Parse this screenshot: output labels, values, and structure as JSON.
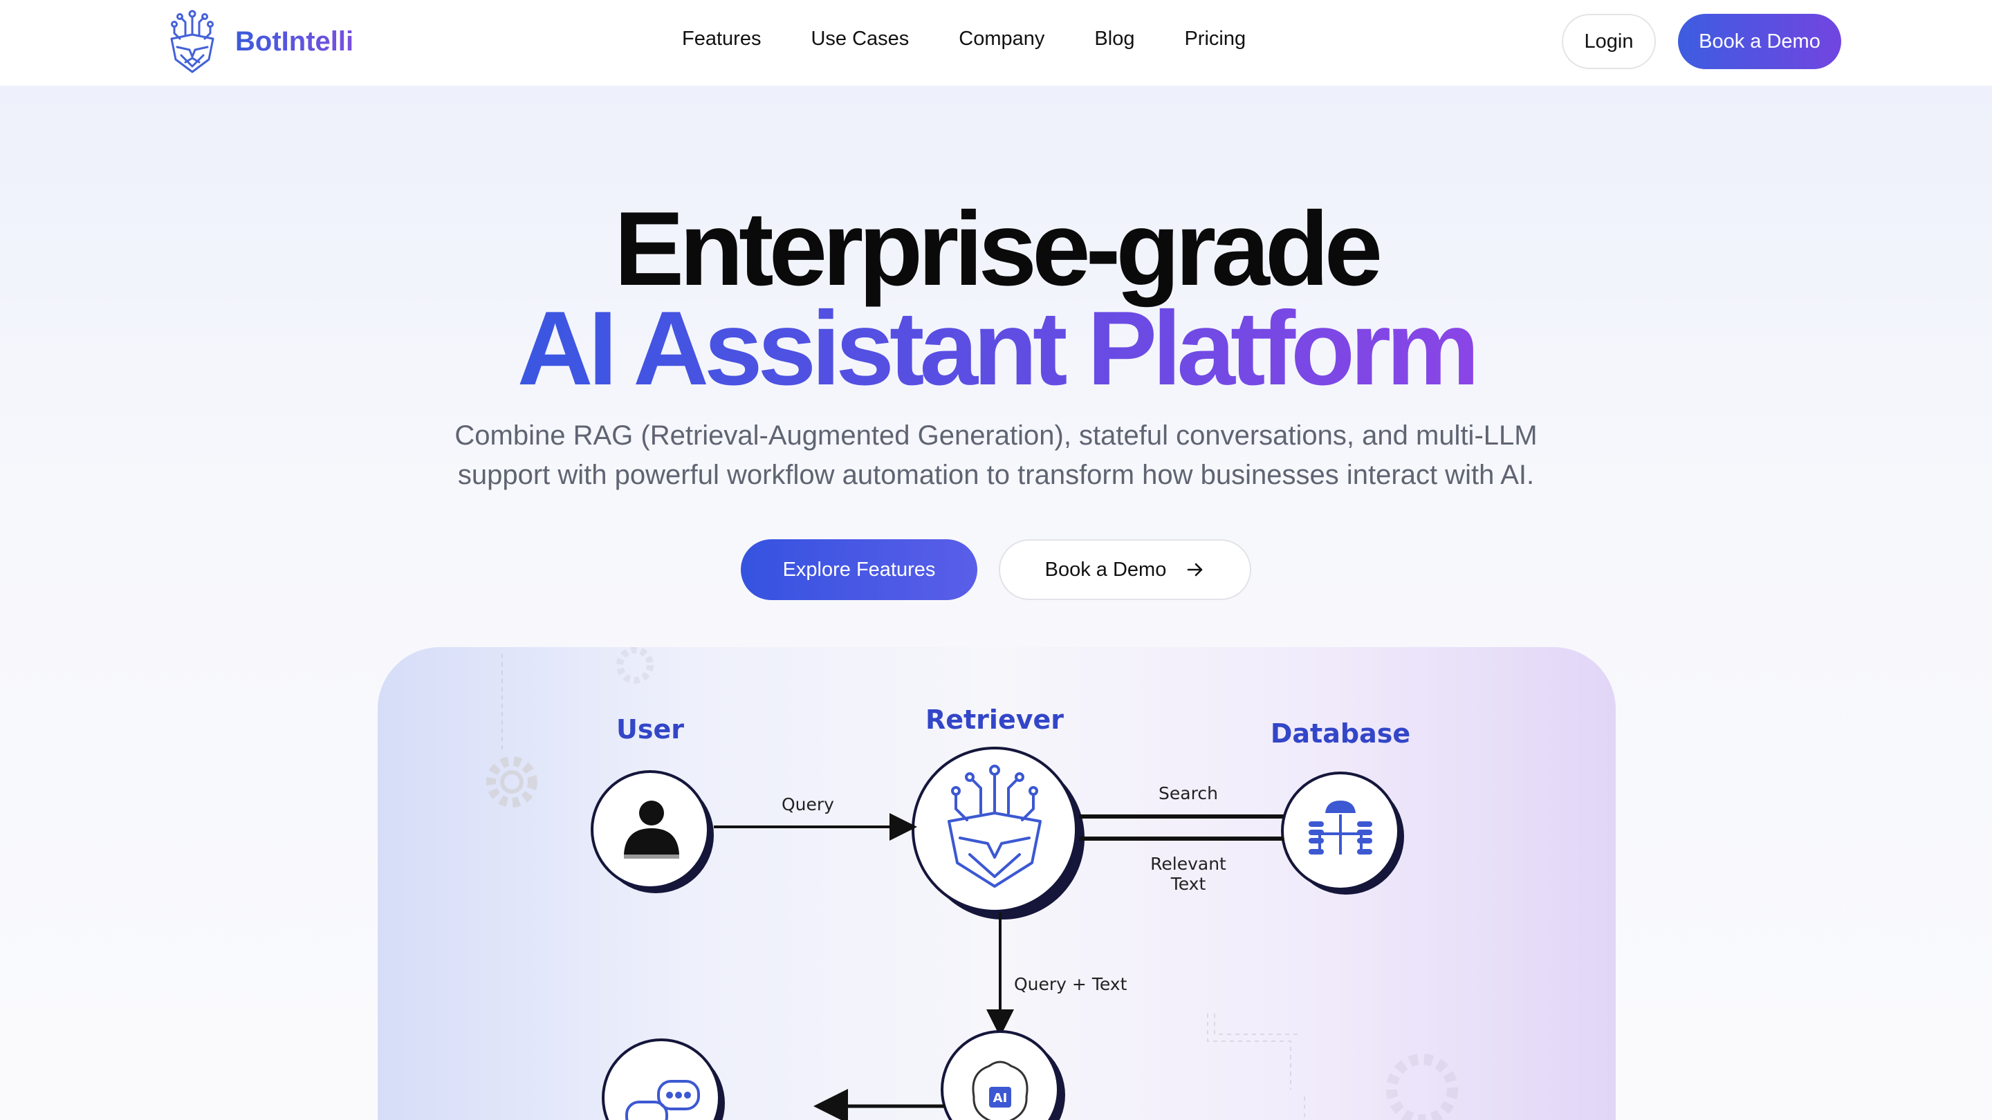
{
  "brand": {
    "name": "BotIntelli"
  },
  "nav": {
    "links": [
      "Features",
      "Use Cases",
      "Company",
      "Blog",
      "Pricing"
    ],
    "login_label": "Login",
    "demo_label": "Book a Demo"
  },
  "hero": {
    "headline_line1": "Enterprise-grade",
    "headline_line2": "AI Assistant Platform",
    "subtitle_line1": "Combine RAG (Retrieval-Augmented Generation), stateful conversations, and multi-LLM",
    "subtitle_line2": "support with powerful workflow automation to transform how businesses interact with AI.",
    "cta_primary": "Explore Features",
    "cta_secondary": "Book a Demo"
  },
  "diagram": {
    "nodes": {
      "user": "User",
      "retriever": "Retriever",
      "database": "Database"
    },
    "edges": {
      "query": "Query",
      "search": "Search",
      "relevant_text_1": "Relevant",
      "relevant_text_2": "Text",
      "query_text": "Query + Text"
    },
    "ai_chip_label": "AI"
  },
  "colors": {
    "accent_blue": "#3a57e2",
    "accent_purple": "#8a45e6",
    "node_title": "#3346c8",
    "node_shadow": "#15163a"
  }
}
